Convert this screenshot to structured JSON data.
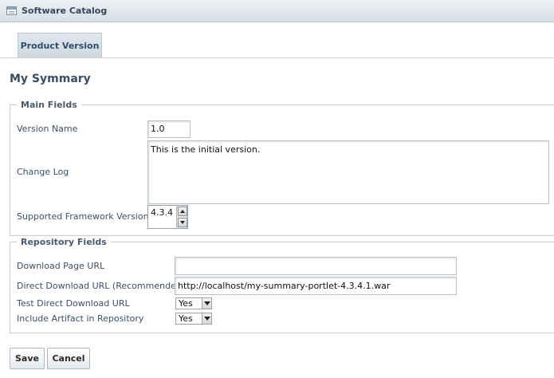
{
  "window": {
    "title": "Software Catalog"
  },
  "tabs": [
    {
      "label": "Product Version"
    }
  ],
  "page": {
    "title": "My Symmary"
  },
  "main_fields": {
    "legend": "Main Fields",
    "version_name": {
      "label": "Version Name",
      "value": "1.0"
    },
    "change_log": {
      "label": "Change Log",
      "value": "This is the initial version."
    },
    "framework_versions": {
      "label": "Supported Framework Versions",
      "selected": "4.3.4"
    }
  },
  "repository_fields": {
    "legend": "Repository Fields",
    "download_page_url": {
      "label": "Download Page URL",
      "value": ""
    },
    "direct_download_url": {
      "label": "Direct Download URL (Recommended)",
      "value": "http://localhost/my-summary-portlet-4.3.4.1.war"
    },
    "test_direct_download_url": {
      "label": "Test Direct Download URL",
      "value": "Yes"
    },
    "include_artifact": {
      "label": "Include Artifact in Repository",
      "value": "Yes"
    }
  },
  "actions": {
    "save_label": "Save",
    "cancel_label": "Cancel"
  }
}
